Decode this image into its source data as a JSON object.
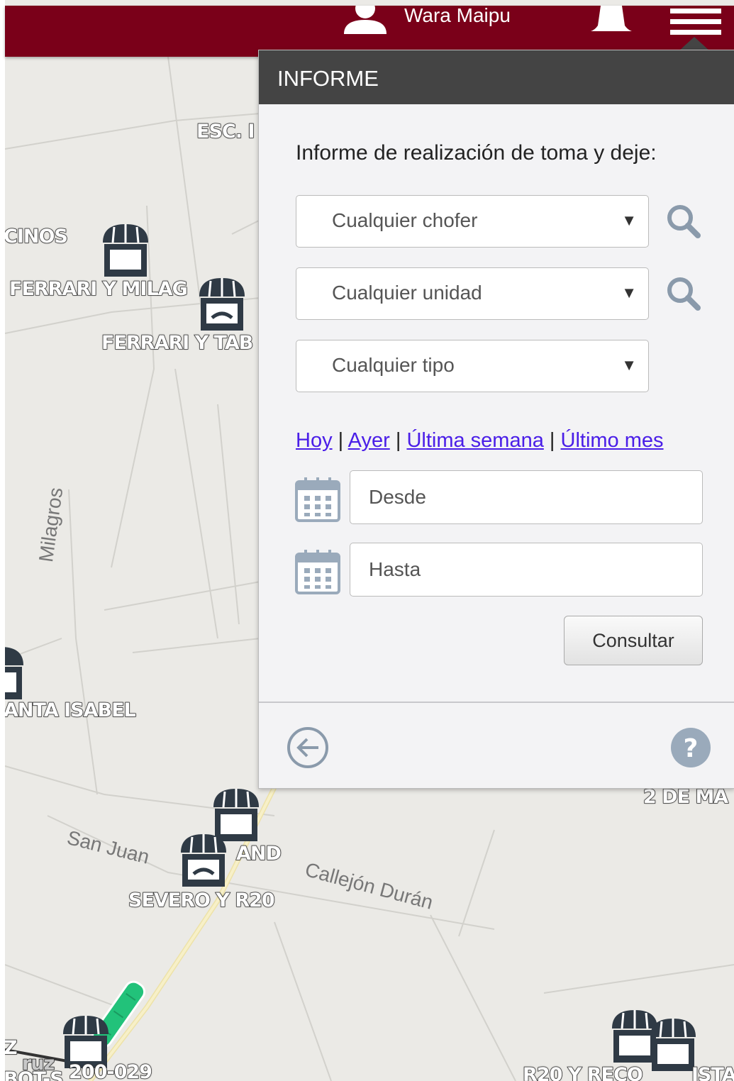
{
  "header": {
    "user_name": "Wara Maipu",
    "icons": [
      "user-icon",
      "bell-icon",
      "menu-icon"
    ],
    "bg_color": "#7a0019"
  },
  "map": {
    "labels": [
      "ESC. I",
      "CINOS",
      "FERRARI Y MILAG",
      "FERRARI Y TAB",
      "ANTA ISABEL",
      "2 DE MA",
      "AND",
      "SEVERO Y R20",
      "200-029",
      "R20 Y RECO",
      "ISTA",
      "Z",
      "ruz",
      "BOT-S"
    ],
    "streets": [
      "Milagros",
      "San Juan",
      "Callejón Durán"
    ]
  },
  "panel": {
    "title": "INFORME",
    "heading": "Informe de realización de toma y deje:",
    "selects": {
      "chofer": "Cualquier chofer",
      "unidad": "Cualquier unidad",
      "tipo": "Cualquier tipo"
    },
    "quick_ranges": {
      "hoy": "Hoy",
      "ayer": "Ayer",
      "semana": "Última semana",
      "mes": "Último mes",
      "separator": "|"
    },
    "date_from_placeholder": "Desde",
    "date_to_placeholder": "Hasta",
    "submit_label": "Consultar",
    "header_color": "#444444",
    "link_color": "#4a1ee8"
  }
}
